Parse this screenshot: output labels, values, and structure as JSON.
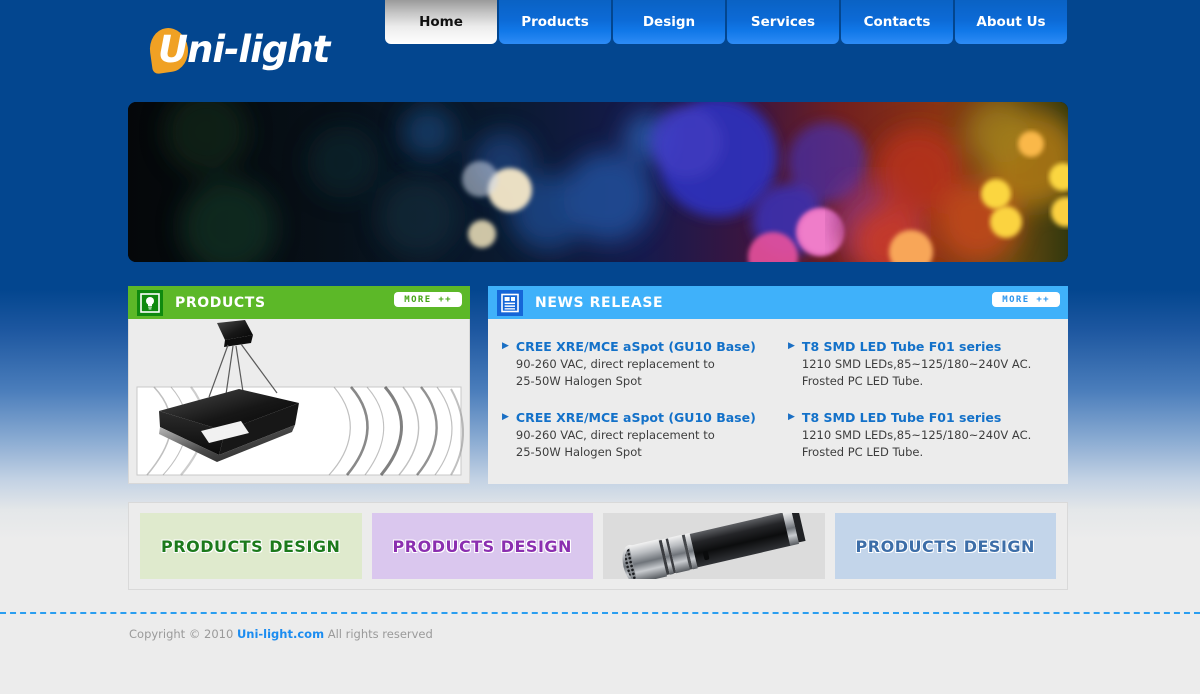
{
  "site": {
    "logo_text": "Uni-light",
    "logo_icon": "water-drop-flame-icon"
  },
  "nav": {
    "items": [
      {
        "label": "Home",
        "active": true
      },
      {
        "label": "Products",
        "active": false
      },
      {
        "label": "Design",
        "active": false
      },
      {
        "label": "Services",
        "active": false
      },
      {
        "label": "Contacts",
        "active": false
      },
      {
        "label": "About Us",
        "active": false
      }
    ]
  },
  "banner": {
    "alt": "colorful bokeh lights banner"
  },
  "products_panel": {
    "icon": "light-bulb-icon",
    "title": "PRODUCTS",
    "more_label": "MORE ++",
    "image_alt": "black square pendant ceiling lamp"
  },
  "news_panel": {
    "icon": "newspaper-icon",
    "title": "NEWS RELEASE",
    "more_label": "MORE ++",
    "items": [
      {
        "title": "CREE XRE/MCE aSpot (GU10 Base)",
        "line1": "90-260 VAC, direct replacement to",
        "line2": "25-50W Halogen Spot"
      },
      {
        "title": "T8 SMD LED Tube F01 series",
        "line1": "1210 SMD LEDs,85~125/180~240V AC.",
        "line2": "Frosted PC LED Tube."
      },
      {
        "title": "CREE XRE/MCE aSpot (GU10 Base)",
        "line1": "90-260 VAC, direct replacement to",
        "line2": "25-50W Halogen Spot"
      },
      {
        "title": "T8 SMD LED Tube F01 series",
        "line1": "1210 SMD LEDs,85~125/180~240V AC.",
        "line2": "Frosted PC LED Tube."
      }
    ]
  },
  "design_strip": {
    "cards": [
      {
        "label": "PRODUCTS DESIGN",
        "bg": "#dfeacd",
        "color": "#1c7a1c",
        "type": "text"
      },
      {
        "label": "PRODUCTS DESIGN",
        "bg": "#dac7ee",
        "color": "#8b2fb0",
        "type": "text"
      },
      {
        "label": "",
        "bg": "#dcdcdc",
        "color": "#000000",
        "type": "image",
        "image_alt": "chrome LED flashlight torch"
      },
      {
        "label": "PRODUCTS DESIGN",
        "bg": "#c3d5ea",
        "color": "#3d6ea8",
        "type": "text"
      }
    ]
  },
  "footer": {
    "copyright_prefix": "Copyright © 2010 ",
    "link": "Uni-light.com",
    "copyright_suffix": " All rights reserved"
  },
  "colors": {
    "page_blue": "#03468f",
    "nav_blue": "#0c6ad6",
    "green": "#5cb828",
    "light_blue": "#3fb1fa",
    "news_link": "#1371c9",
    "orange": "#f0a124",
    "footer_gray": "#ececec"
  }
}
